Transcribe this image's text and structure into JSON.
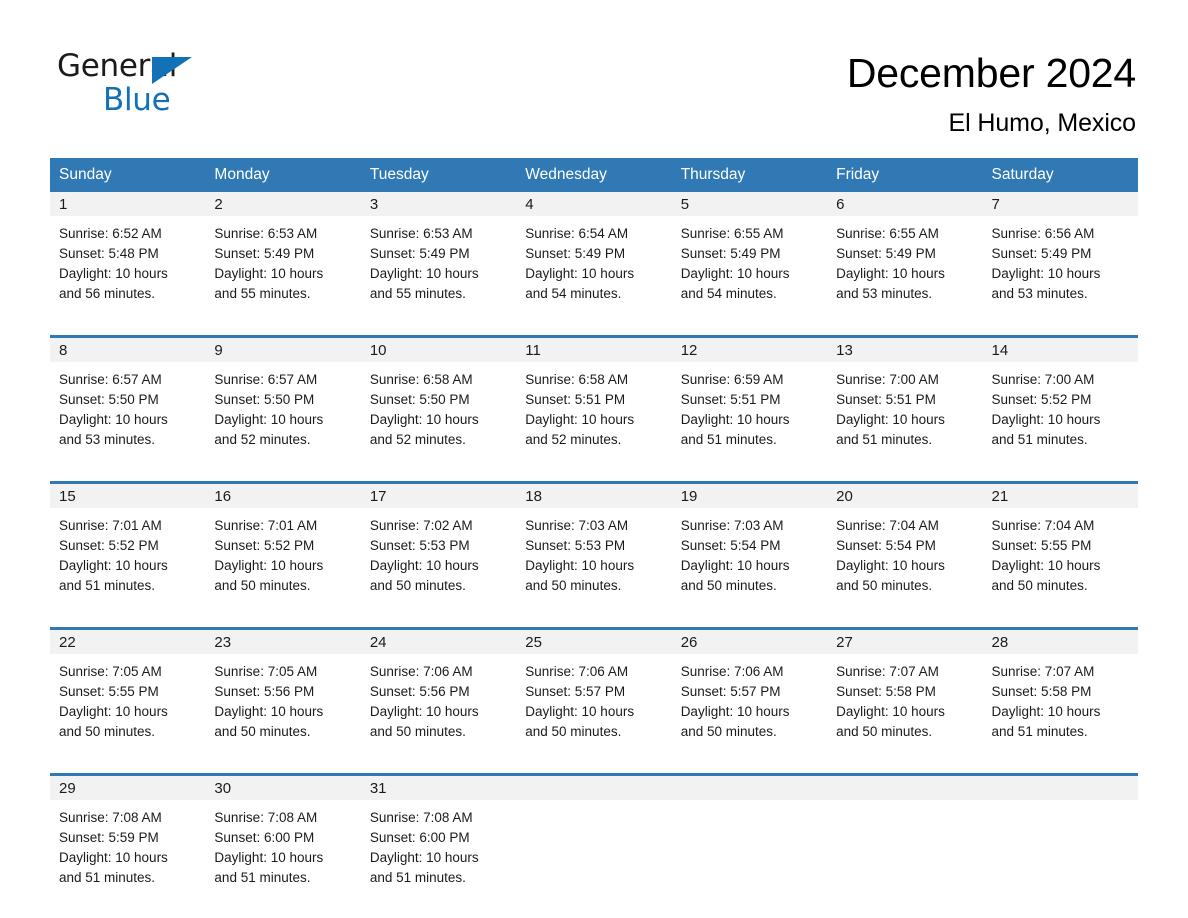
{
  "brand": {
    "word1": "General",
    "word2": "Blue",
    "triangle_color": "#1371b7",
    "triangle_name": "general-blue-logo-triangle"
  },
  "header": {
    "month_title": "December 2024",
    "location": "El Humo, Mexico"
  },
  "calendar": {
    "header_bg": "#3079b5",
    "daynum_bg": "#f2f2f2",
    "weekday_headers": [
      "Sunday",
      "Monday",
      "Tuesday",
      "Wednesday",
      "Thursday",
      "Friday",
      "Saturday"
    ],
    "weeks": [
      [
        {
          "day": "1",
          "sunrise": "Sunrise: 6:52 AM",
          "sunset": "Sunset: 5:48 PM",
          "daylight_line1": "Daylight: 10 hours",
          "daylight_line2": "and 56 minutes."
        },
        {
          "day": "2",
          "sunrise": "Sunrise: 6:53 AM",
          "sunset": "Sunset: 5:49 PM",
          "daylight_line1": "Daylight: 10 hours",
          "daylight_line2": "and 55 minutes."
        },
        {
          "day": "3",
          "sunrise": "Sunrise: 6:53 AM",
          "sunset": "Sunset: 5:49 PM",
          "daylight_line1": "Daylight: 10 hours",
          "daylight_line2": "and 55 minutes."
        },
        {
          "day": "4",
          "sunrise": "Sunrise: 6:54 AM",
          "sunset": "Sunset: 5:49 PM",
          "daylight_line1": "Daylight: 10 hours",
          "daylight_line2": "and 54 minutes."
        },
        {
          "day": "5",
          "sunrise": "Sunrise: 6:55 AM",
          "sunset": "Sunset: 5:49 PM",
          "daylight_line1": "Daylight: 10 hours",
          "daylight_line2": "and 54 minutes."
        },
        {
          "day": "6",
          "sunrise": "Sunrise: 6:55 AM",
          "sunset": "Sunset: 5:49 PM",
          "daylight_line1": "Daylight: 10 hours",
          "daylight_line2": "and 53 minutes."
        },
        {
          "day": "7",
          "sunrise": "Sunrise: 6:56 AM",
          "sunset": "Sunset: 5:49 PM",
          "daylight_line1": "Daylight: 10 hours",
          "daylight_line2": "and 53 minutes."
        }
      ],
      [
        {
          "day": "8",
          "sunrise": "Sunrise: 6:57 AM",
          "sunset": "Sunset: 5:50 PM",
          "daylight_line1": "Daylight: 10 hours",
          "daylight_line2": "and 53 minutes."
        },
        {
          "day": "9",
          "sunrise": "Sunrise: 6:57 AM",
          "sunset": "Sunset: 5:50 PM",
          "daylight_line1": "Daylight: 10 hours",
          "daylight_line2": "and 52 minutes."
        },
        {
          "day": "10",
          "sunrise": "Sunrise: 6:58 AM",
          "sunset": "Sunset: 5:50 PM",
          "daylight_line1": "Daylight: 10 hours",
          "daylight_line2": "and 52 minutes."
        },
        {
          "day": "11",
          "sunrise": "Sunrise: 6:58 AM",
          "sunset": "Sunset: 5:51 PM",
          "daylight_line1": "Daylight: 10 hours",
          "daylight_line2": "and 52 minutes."
        },
        {
          "day": "12",
          "sunrise": "Sunrise: 6:59 AM",
          "sunset": "Sunset: 5:51 PM",
          "daylight_line1": "Daylight: 10 hours",
          "daylight_line2": "and 51 minutes."
        },
        {
          "day": "13",
          "sunrise": "Sunrise: 7:00 AM",
          "sunset": "Sunset: 5:51 PM",
          "daylight_line1": "Daylight: 10 hours",
          "daylight_line2": "and 51 minutes."
        },
        {
          "day": "14",
          "sunrise": "Sunrise: 7:00 AM",
          "sunset": "Sunset: 5:52 PM",
          "daylight_line1": "Daylight: 10 hours",
          "daylight_line2": "and 51 minutes."
        }
      ],
      [
        {
          "day": "15",
          "sunrise": "Sunrise: 7:01 AM",
          "sunset": "Sunset: 5:52 PM",
          "daylight_line1": "Daylight: 10 hours",
          "daylight_line2": "and 51 minutes."
        },
        {
          "day": "16",
          "sunrise": "Sunrise: 7:01 AM",
          "sunset": "Sunset: 5:52 PM",
          "daylight_line1": "Daylight: 10 hours",
          "daylight_line2": "and 50 minutes."
        },
        {
          "day": "17",
          "sunrise": "Sunrise: 7:02 AM",
          "sunset": "Sunset: 5:53 PM",
          "daylight_line1": "Daylight: 10 hours",
          "daylight_line2": "and 50 minutes."
        },
        {
          "day": "18",
          "sunrise": "Sunrise: 7:03 AM",
          "sunset": "Sunset: 5:53 PM",
          "daylight_line1": "Daylight: 10 hours",
          "daylight_line2": "and 50 minutes."
        },
        {
          "day": "19",
          "sunrise": "Sunrise: 7:03 AM",
          "sunset": "Sunset: 5:54 PM",
          "daylight_line1": "Daylight: 10 hours",
          "daylight_line2": "and 50 minutes."
        },
        {
          "day": "20",
          "sunrise": "Sunrise: 7:04 AM",
          "sunset": "Sunset: 5:54 PM",
          "daylight_line1": "Daylight: 10 hours",
          "daylight_line2": "and 50 minutes."
        },
        {
          "day": "21",
          "sunrise": "Sunrise: 7:04 AM",
          "sunset": "Sunset: 5:55 PM",
          "daylight_line1": "Daylight: 10 hours",
          "daylight_line2": "and 50 minutes."
        }
      ],
      [
        {
          "day": "22",
          "sunrise": "Sunrise: 7:05 AM",
          "sunset": "Sunset: 5:55 PM",
          "daylight_line1": "Daylight: 10 hours",
          "daylight_line2": "and 50 minutes."
        },
        {
          "day": "23",
          "sunrise": "Sunrise: 7:05 AM",
          "sunset": "Sunset: 5:56 PM",
          "daylight_line1": "Daylight: 10 hours",
          "daylight_line2": "and 50 minutes."
        },
        {
          "day": "24",
          "sunrise": "Sunrise: 7:06 AM",
          "sunset": "Sunset: 5:56 PM",
          "daylight_line1": "Daylight: 10 hours",
          "daylight_line2": "and 50 minutes."
        },
        {
          "day": "25",
          "sunrise": "Sunrise: 7:06 AM",
          "sunset": "Sunset: 5:57 PM",
          "daylight_line1": "Daylight: 10 hours",
          "daylight_line2": "and 50 minutes."
        },
        {
          "day": "26",
          "sunrise": "Sunrise: 7:06 AM",
          "sunset": "Sunset: 5:57 PM",
          "daylight_line1": "Daylight: 10 hours",
          "daylight_line2": "and 50 minutes."
        },
        {
          "day": "27",
          "sunrise": "Sunrise: 7:07 AM",
          "sunset": "Sunset: 5:58 PM",
          "daylight_line1": "Daylight: 10 hours",
          "daylight_line2": "and 50 minutes."
        },
        {
          "day": "28",
          "sunrise": "Sunrise: 7:07 AM",
          "sunset": "Sunset: 5:58 PM",
          "daylight_line1": "Daylight: 10 hours",
          "daylight_line2": "and 51 minutes."
        }
      ],
      [
        {
          "day": "29",
          "sunrise": "Sunrise: 7:08 AM",
          "sunset": "Sunset: 5:59 PM",
          "daylight_line1": "Daylight: 10 hours",
          "daylight_line2": "and 51 minutes."
        },
        {
          "day": "30",
          "sunrise": "Sunrise: 7:08 AM",
          "sunset": "Sunset: 6:00 PM",
          "daylight_line1": "Daylight: 10 hours",
          "daylight_line2": "and 51 minutes."
        },
        {
          "day": "31",
          "sunrise": "Sunrise: 7:08 AM",
          "sunset": "Sunset: 6:00 PM",
          "daylight_line1": "Daylight: 10 hours",
          "daylight_line2": "and 51 minutes."
        },
        {
          "day": "",
          "sunrise": "",
          "sunset": "",
          "daylight_line1": "",
          "daylight_line2": ""
        },
        {
          "day": "",
          "sunrise": "",
          "sunset": "",
          "daylight_line1": "",
          "daylight_line2": ""
        },
        {
          "day": "",
          "sunrise": "",
          "sunset": "",
          "daylight_line1": "",
          "daylight_line2": ""
        },
        {
          "day": "",
          "sunrise": "",
          "sunset": "",
          "daylight_line1": "",
          "daylight_line2": ""
        }
      ]
    ]
  }
}
